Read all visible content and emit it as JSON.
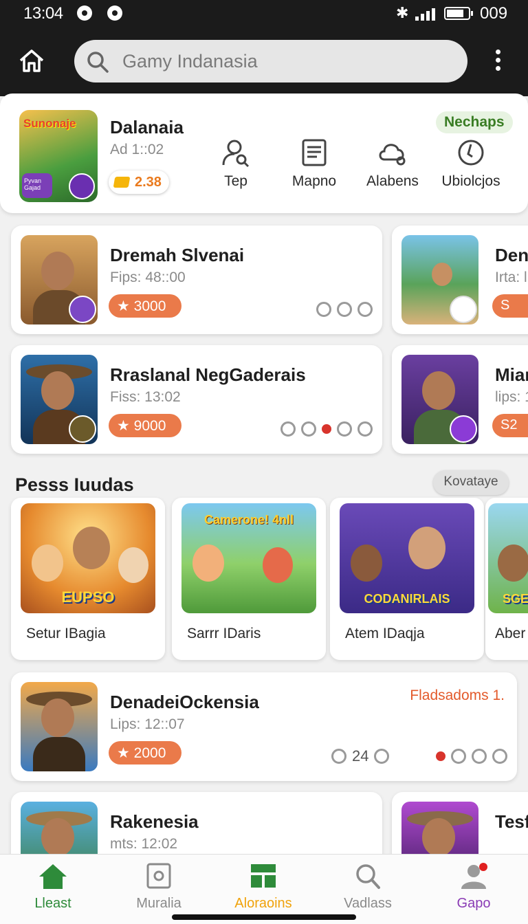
{
  "status_bar": {
    "time": "13:04",
    "battery_text": "009"
  },
  "search": {
    "placeholder": "Gamy Indanasia"
  },
  "header_card": {
    "thumb_logo": "Sunonaje",
    "thumb_mini": "Pyvan\nGajad",
    "title": "Dalanaia",
    "subtitle": "Ad 1::02",
    "coins": "2.38",
    "badge": "Nechaps",
    "actions": [
      {
        "label": "Tep",
        "icon": "user-search-icon"
      },
      {
        "label": "Mapno",
        "icon": "document-icon"
      },
      {
        "label": "Alabens",
        "icon": "cloud-person-icon"
      },
      {
        "label": "Ubiolcjos",
        "icon": "clock-icon"
      }
    ]
  },
  "list": [
    {
      "name": "Dremah Slvenai",
      "meta": "Fips: 48::00",
      "points": "★ 3000"
    },
    {
      "name": "Rraslanal NegGaderais",
      "meta": "Fiss: 13:02",
      "points": "★ 9000"
    }
  ],
  "side_list": [
    {
      "name": "Den",
      "meta": "Irta: l",
      "points": "S"
    },
    {
      "name": "Mian",
      "meta": "lips: 1",
      "points": "S2"
    }
  ],
  "section": {
    "title": "Pesss Iuudas",
    "button": "Kovataye"
  },
  "featured": [
    {
      "art_text": "EUPSO",
      "caption": "Setur IBagia"
    },
    {
      "art_text": "Camerone! 4nll",
      "caption": "Sarrr IDaris"
    },
    {
      "art_text": "CODANIRLAIS",
      "caption": "Atem IDaqja"
    },
    {
      "art_text": "SGE",
      "caption": "Aber"
    }
  ],
  "list2": [
    {
      "name": "DenadeiOckensia",
      "meta": "Lips: 12::07",
      "points": "★ 2000",
      "tag": "Fladsadoms 1.",
      "count": "24"
    },
    {
      "name": "Rakenesia",
      "meta": "mts: 12:02"
    }
  ],
  "side_list2": {
    "name": "Tesf"
  },
  "bottom_nav": [
    {
      "label": "Lleast",
      "color": "#2e8b3a",
      "active": true
    },
    {
      "label": "Muralia",
      "color": "#8a8a8a"
    },
    {
      "label": "Aloraoins",
      "color": "#f0a20a"
    },
    {
      "label": "Vadlass",
      "color": "#8a8a8a"
    },
    {
      "label": "Gapo",
      "color": "#8a3bb5"
    }
  ],
  "colors": {
    "accent_orange": "#ea7a4a",
    "badge_green": "#3a7d24",
    "topbar": "#1b1b1b"
  }
}
